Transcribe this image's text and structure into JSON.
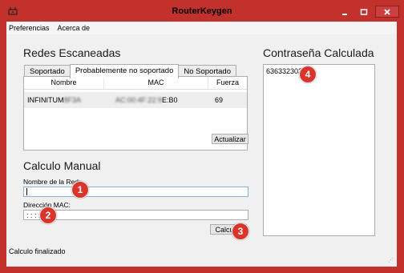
{
  "window": {
    "title": "RouterKeygen"
  },
  "menu": [
    "Preferencias",
    "Acerca de"
  ],
  "scanned": {
    "heading": "Redes Escaneadas",
    "tabs": [
      "Soportado",
      "Probablemente no soportado",
      "No Soportado"
    ],
    "active_tab": "Probablemente no soportado",
    "columns": [
      "Nombre",
      "MAC",
      "Fuerza"
    ],
    "rows": [
      {
        "name_visible": "INFINITUM",
        "name_hidden": "8F3A",
        "mac_hidden": "AC:00:4F:22:9",
        "mac_visible": "E:B0",
        "strength": "69"
      }
    ],
    "refresh_label": "Actualizar"
  },
  "manual": {
    "heading": "Calculo Manual",
    "name_label": "Nombre de la Red:",
    "name_value": "",
    "mac_label": "Dirección MAC:",
    "mac_value": " :  :  :  :  :",
    "calc_label": "Calcular"
  },
  "result": {
    "heading": "Contraseña Calculada",
    "password": "6363323038"
  },
  "markers": [
    "1",
    "2",
    "3",
    "4"
  ],
  "status": "Calculo finalizado",
  "colors": {
    "frame": "#c2312b",
    "marker": "#d9352b",
    "client": "#f0f0f0"
  }
}
